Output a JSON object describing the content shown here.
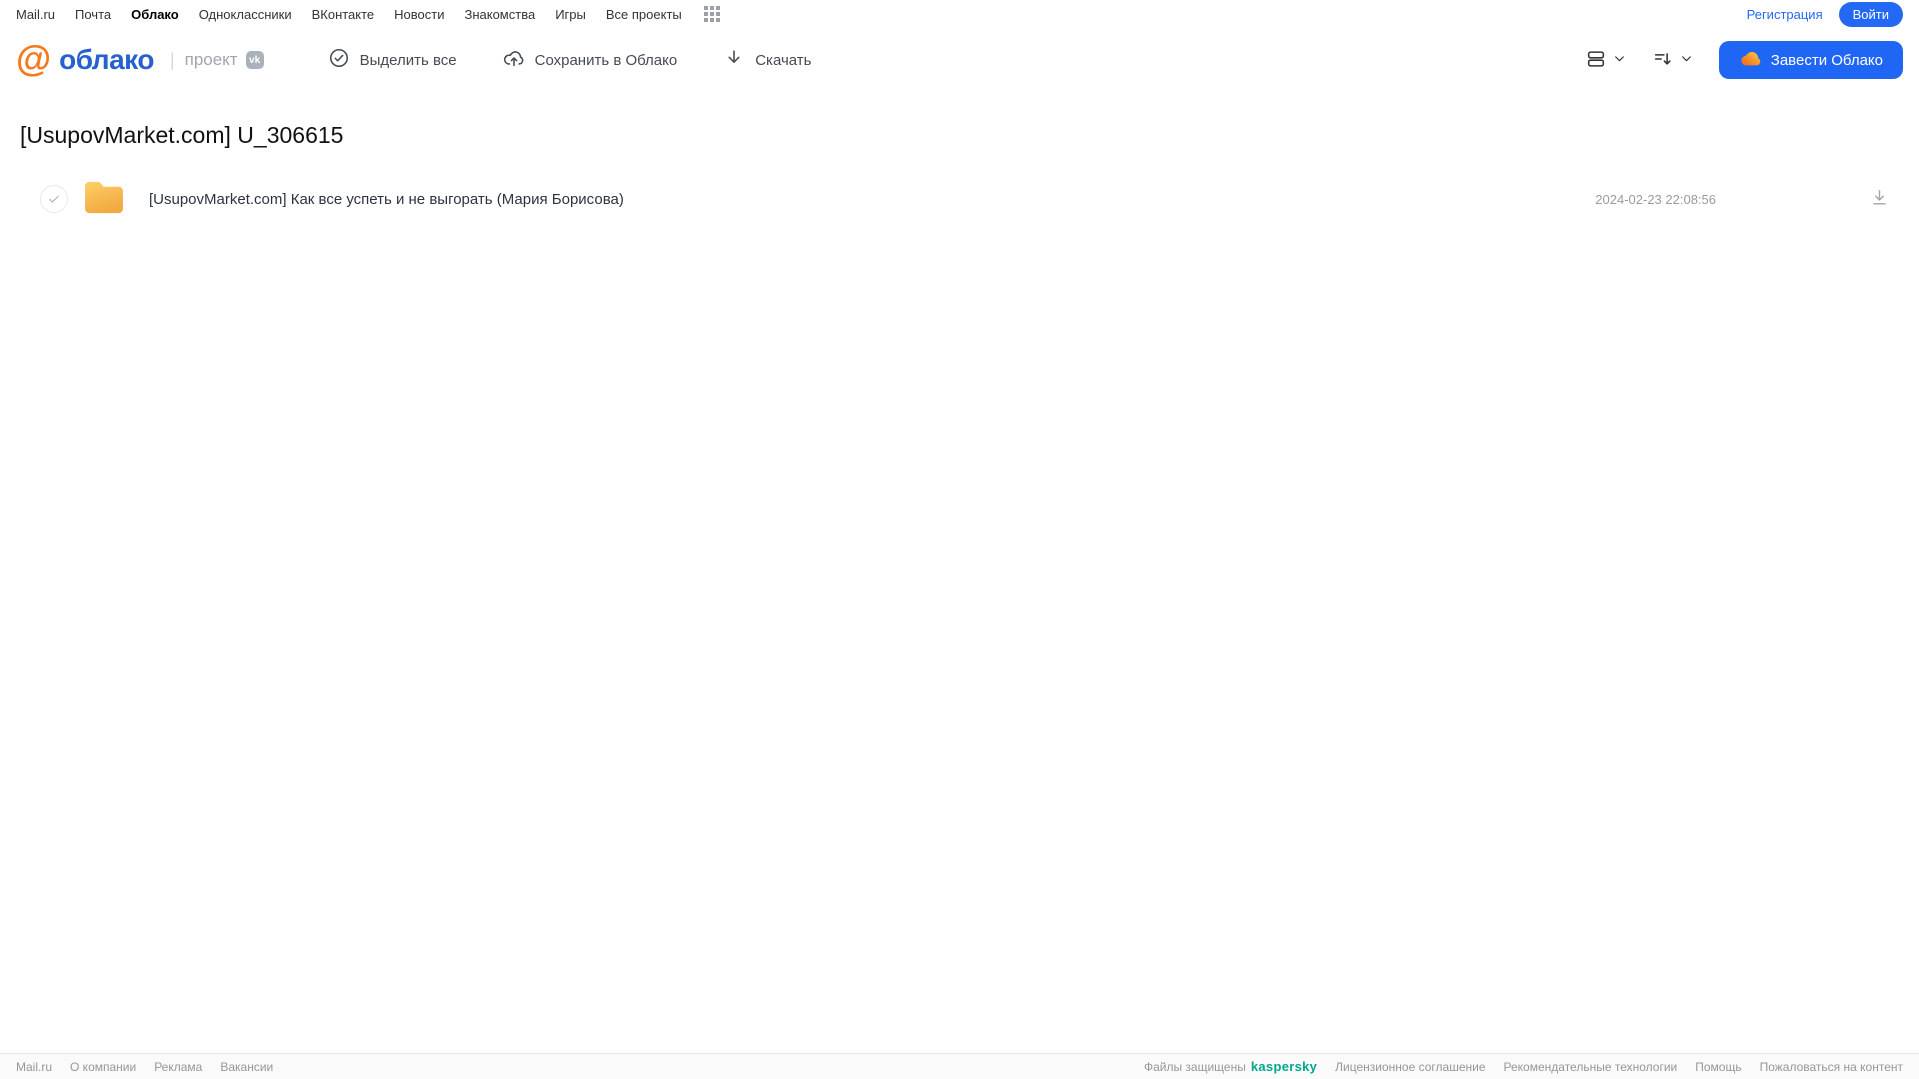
{
  "topnav": {
    "links": [
      "Mail.ru",
      "Почта",
      "Облако",
      "Одноклассники",
      "ВКонтакте",
      "Новости",
      "Знакомства",
      "Игры",
      "Все проекты"
    ],
    "active_link": "Облако",
    "register_label": "Регистрация",
    "login_label": "Войти"
  },
  "header": {
    "logo": {
      "brand": "облако",
      "separator": "|",
      "project": "проект",
      "vk_badge": "vk"
    },
    "toolbar": {
      "select_all": "Выделить все",
      "save_to_cloud": "Сохранить в Облако",
      "download": "Скачать"
    },
    "create_cloud_label": "Завести Облако"
  },
  "main": {
    "title": "[UsupovMarket.com] U_306615",
    "files": [
      {
        "type": "folder",
        "name": "[UsupovMarket.com] Как все успеть и не выгорать (Мария Борисова)",
        "modified": "2024-02-23 22:08:56"
      }
    ]
  },
  "footer": {
    "left_links": [
      "Mail.ru",
      "О компании",
      "Реклама",
      "Вакансии"
    ],
    "protected_label": "Файлы защищены",
    "kaspersky_label": "kaspersky",
    "right_links": [
      "Лицензионное соглашение",
      "Рекомендательные технологии",
      "Помощь",
      "Пожаловаться на контент"
    ]
  },
  "colors": {
    "accent_blue": "#2469f5",
    "logo_blue": "#2760cf",
    "logo_orange": "#f5791d",
    "folder_yellow": "#fbc253",
    "kaspersky_green": "#00a88e"
  }
}
